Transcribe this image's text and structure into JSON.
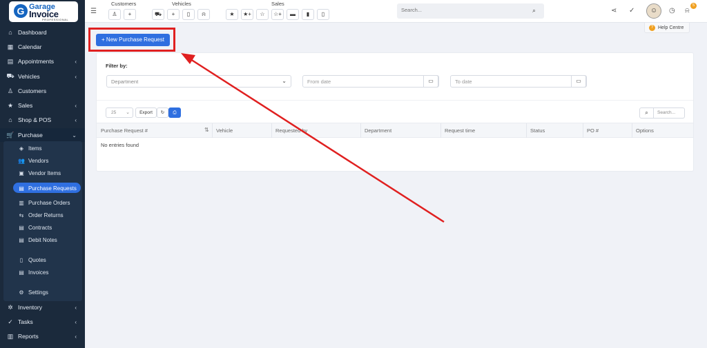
{
  "sidebar": {
    "logo": {
      "line1": "Garage",
      "line2": "Invoice",
      "line3": "PROFESSIONAL",
      "mark": "G"
    },
    "items": [
      {
        "label": "Dashboard",
        "icon": "home-icon",
        "glyph": "⌂",
        "chev": ""
      },
      {
        "label": "Calendar",
        "icon": "calendar-icon",
        "glyph": "▦",
        "chev": ""
      },
      {
        "label": "Appointments",
        "icon": "appointments-icon",
        "glyph": "▤",
        "chev": "‹"
      },
      {
        "label": "Vehicles",
        "icon": "car-icon",
        "glyph": "⛟",
        "chev": "‹"
      },
      {
        "label": "Customers",
        "icon": "user-icon",
        "glyph": "♙",
        "chev": ""
      },
      {
        "label": "Sales",
        "icon": "star-icon",
        "glyph": "★",
        "chev": "‹"
      },
      {
        "label": "Shop & POS",
        "icon": "shop-icon",
        "glyph": "⌂",
        "chev": "‹"
      },
      {
        "label": "Purchase",
        "icon": "cart-icon",
        "glyph": "🛒",
        "chev": "⌄"
      }
    ],
    "sub_items": [
      {
        "label": "Items",
        "glyph": "◈"
      },
      {
        "label": "Vendors",
        "glyph": "👥"
      },
      {
        "label": "Vendor Items",
        "glyph": "▣"
      },
      {
        "label": "Purchase Requests",
        "glyph": "▤"
      },
      {
        "label": "Purchase Orders",
        "glyph": "▥"
      },
      {
        "label": "Order Returns",
        "glyph": "⇆"
      },
      {
        "label": "Contracts",
        "glyph": "▤"
      },
      {
        "label": "Debit Notes",
        "glyph": "▤"
      },
      {
        "label": "Quotes",
        "glyph": "▯"
      },
      {
        "label": "Invoices",
        "glyph": "▤"
      },
      {
        "label": "Settings",
        "glyph": "⚙"
      }
    ],
    "bottom_items": [
      {
        "label": "Inventory",
        "glyph": "✲",
        "chev": "‹"
      },
      {
        "label": "Tasks",
        "glyph": "✓",
        "chev": "‹"
      },
      {
        "label": "Reports",
        "glyph": "▥",
        "chev": "‹"
      }
    ]
  },
  "topbar": {
    "groups": [
      "Customers",
      "Vehicles",
      "Sales"
    ],
    "search_placeholder": "Search...",
    "notification_count": "5"
  },
  "help": {
    "label": "Help Centre"
  },
  "page": {
    "new_button": "+ New Purchase Request",
    "filter_label": "Filter by:",
    "department_placeholder": "Department",
    "from_placeholder": "From date",
    "to_placeholder": "To date",
    "page_size": "25",
    "export_label": "Export",
    "search_placeholder": "Search...",
    "columns": [
      "Purchase Request #",
      "Vehicle",
      "Requested by",
      "Department",
      "Request time",
      "Status",
      "PO #",
      "Options"
    ],
    "empty_text": "No entries found"
  },
  "colors": {
    "accent": "#2f6fe0",
    "sidebar": "#1b2a3c",
    "highlight": "#e02020"
  }
}
